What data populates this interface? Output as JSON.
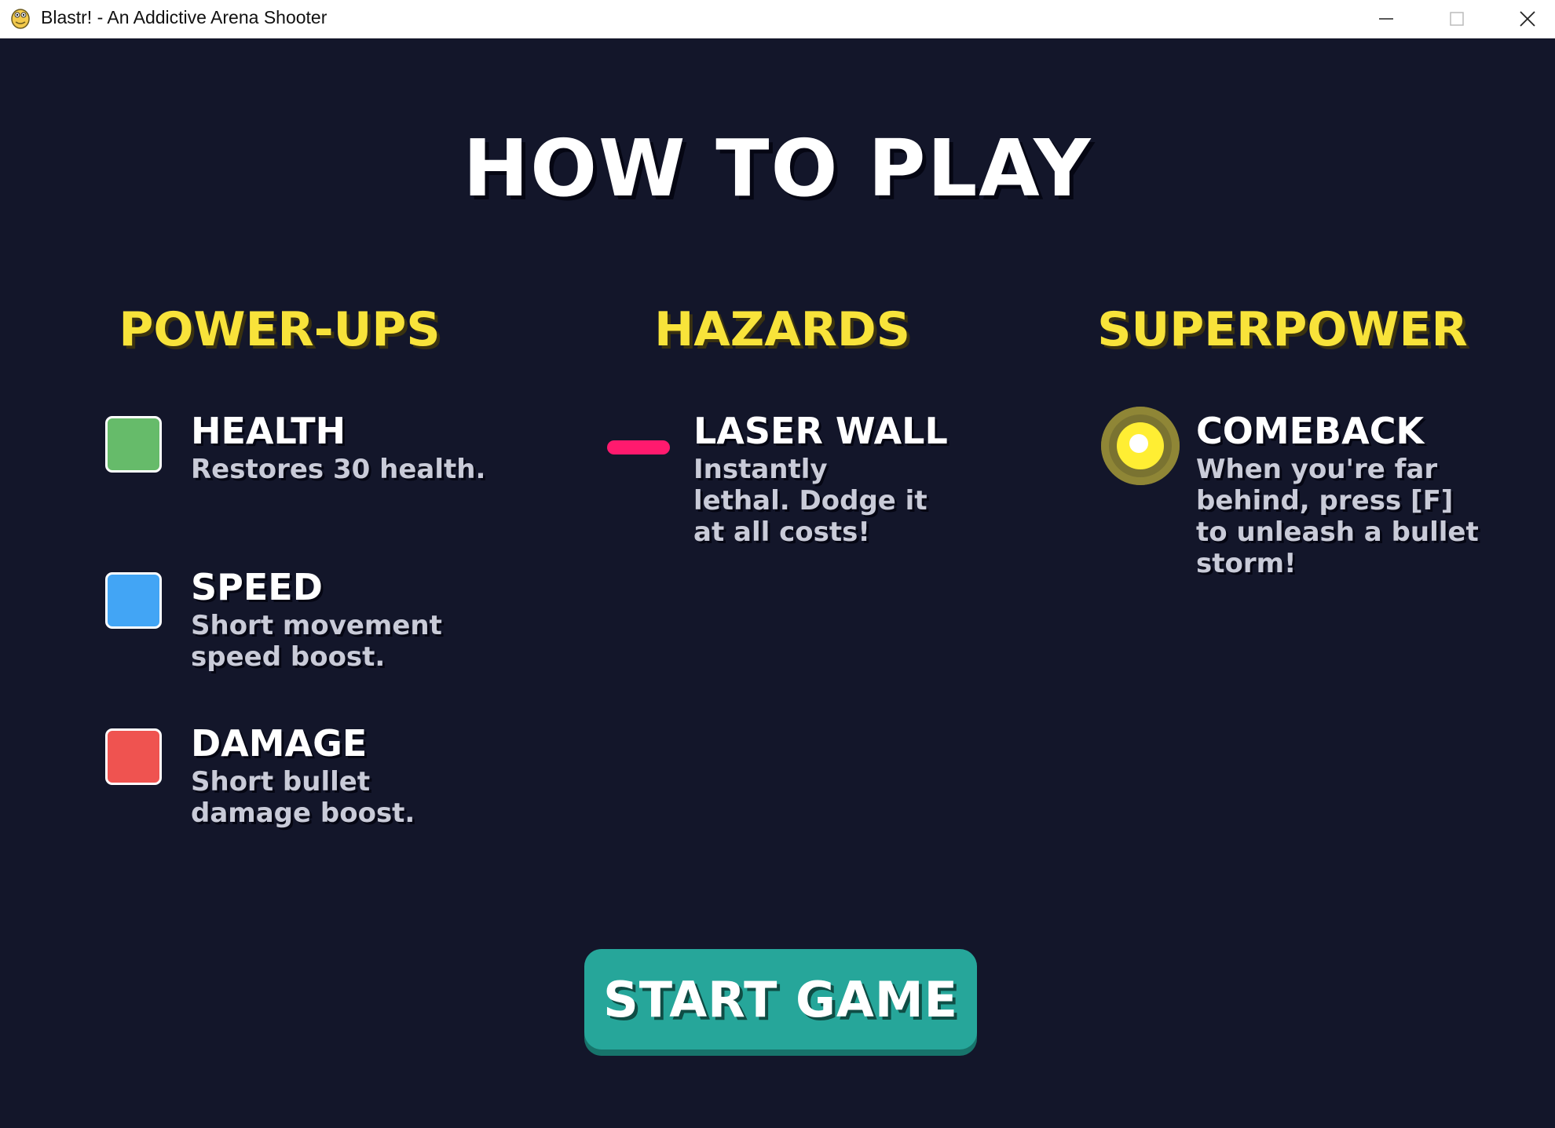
{
  "window": {
    "title": "Blastr! - An Addictive Arena Shooter",
    "icon": "python-icon"
  },
  "page": {
    "title": "HOW TO PLAY"
  },
  "sections": {
    "powerups": {
      "heading": "POWER-UPS",
      "items": [
        {
          "name": "HEALTH",
          "description": "Restores 30 health.",
          "color": "#66bb6a"
        },
        {
          "name": "SPEED",
          "description": "Short movement speed boost.",
          "color": "#42a5f5"
        },
        {
          "name": "DAMAGE",
          "description": "Short bullet damage boost.",
          "color": "#ef5350"
        }
      ]
    },
    "hazards": {
      "heading": "HAZARDS",
      "items": [
        {
          "name": "LASER WALL",
          "description": "Instantly lethal. Dodge it at all costs!",
          "color": "#ff1a6e"
        }
      ]
    },
    "superpower": {
      "heading": "SUPERPOWER",
      "items": [
        {
          "name": "COMEBACK",
          "description": "When you're far behind, press [F] to unleash a bullet storm!",
          "color": "#ffee33"
        }
      ]
    }
  },
  "start_button": {
    "label": "START GAME",
    "color": "#26a69a"
  },
  "colors": {
    "background": "#13162a",
    "heading": "#f8e33a",
    "text": "#ffffff",
    "description": "#c9cbd8"
  }
}
